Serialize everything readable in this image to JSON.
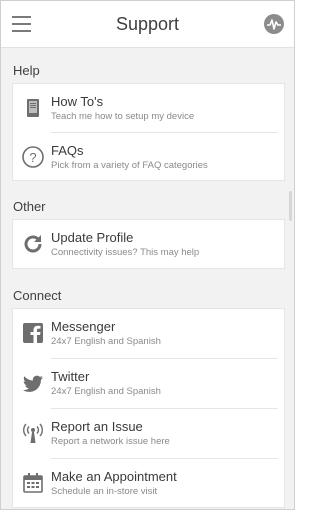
{
  "header": {
    "title": "Support",
    "menu_icon": "hamburger-menu-icon",
    "status_icon": "network-status-icon"
  },
  "sections": {
    "help": {
      "label": "Help",
      "items": [
        {
          "title": "How To's",
          "subtitle": "Teach me how to setup my device",
          "icon": "device-icon"
        },
        {
          "title": "FAQs",
          "subtitle": "Pick from a variety of FAQ categories",
          "icon": "question-circle-icon"
        }
      ]
    },
    "other": {
      "label": "Other",
      "items": [
        {
          "title": "Update Profile",
          "subtitle": "Connectivity issues? This may help",
          "icon": "refresh-icon"
        }
      ]
    },
    "connect": {
      "label": "Connect",
      "items": [
        {
          "title": "Messenger",
          "subtitle": "24x7 English and Spanish",
          "icon": "facebook-icon"
        },
        {
          "title": "Twitter",
          "subtitle": "24x7 English and Spanish",
          "icon": "twitter-icon"
        },
        {
          "title": "Report an Issue",
          "subtitle": "Report a network issue here",
          "icon": "signal-tower-icon"
        },
        {
          "title": "Make an Appointment",
          "subtitle": "Schedule an in-store visit",
          "icon": "calendar-icon"
        }
      ]
    }
  }
}
